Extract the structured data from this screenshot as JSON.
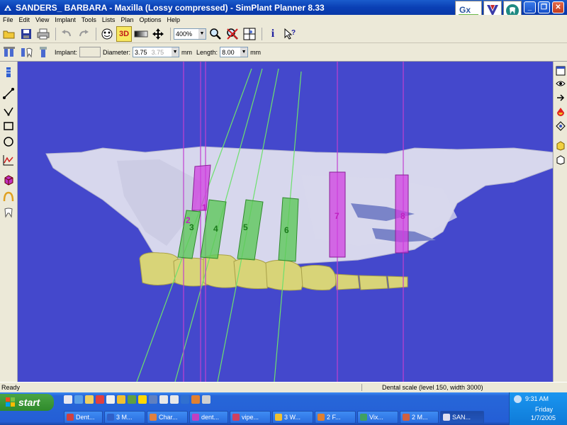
{
  "window": {
    "title": "SANDERS_ BARBARA - Maxilla (Lossy compressed) - SimPlant Planner 8.33",
    "logos": [
      "Gx",
      "V",
      "tooth"
    ]
  },
  "menu": [
    "File",
    "Edit",
    "View",
    "Implant",
    "Tools",
    "Lists",
    "Plan",
    "Options",
    "Help"
  ],
  "toolbar": {
    "zoom_value": "400%",
    "view3d_label": "3D",
    "info_label": "i"
  },
  "implant_bar": {
    "implant_label": "Implant:",
    "implant_value": "",
    "diameter_label": "Diameter:",
    "diameter_value": "3.75",
    "diameter_value2": "3.75",
    "diameter_unit": "mm",
    "length_label": "Length:",
    "length_value": "8.00",
    "length_unit": "mm"
  },
  "implants": [
    "1",
    "2",
    "3",
    "4",
    "5",
    "6",
    "7",
    "8"
  ],
  "status": {
    "left": "Ready",
    "right": "Dental scale (level 150, width 3000)"
  },
  "taskbar": {
    "start_label": "start",
    "tasks": [
      "Dent...",
      "3 M...",
      "Char...",
      "dent...",
      "vipe...",
      "3 W...",
      "2 F...",
      "Vix...",
      "2 M...",
      "SAN..."
    ],
    "time": "9:31 AM",
    "day": "Friday",
    "date": "1/7/2005"
  },
  "colors": {
    "viewport_bg": "#4448cc",
    "implant_green": "#5ec85a",
    "implant_magenta": "#d040e0",
    "guide_line": "#6de06d",
    "bone": "#e8e8f4",
    "teeth": "#d8d478"
  }
}
